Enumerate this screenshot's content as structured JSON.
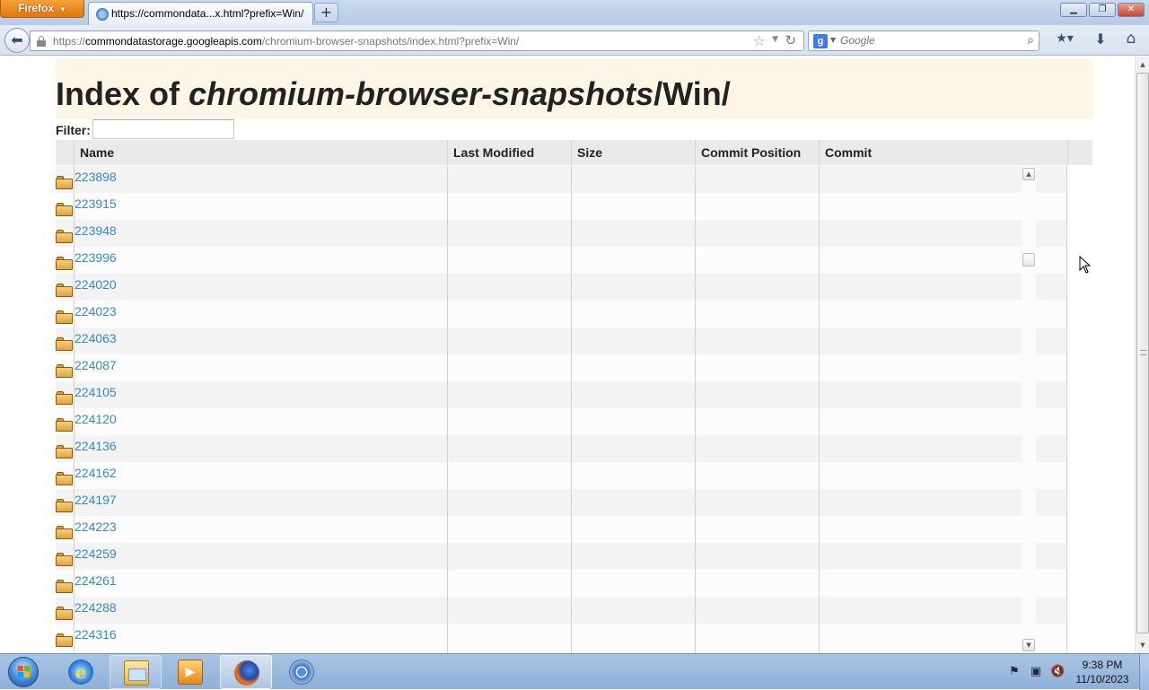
{
  "browser": {
    "menu_button": "Firefox",
    "tab_title": "https://commondata...x.html?prefix=Win/",
    "url_host": "commondatastorage.googleapis.com",
    "url_scheme": "https://",
    "url_path": "/chromium-browser-snapshots/index.html?prefix=Win/",
    "search_placeholder": "Google",
    "icons": [
      "back-icon",
      "lock-icon",
      "star-icon",
      "reload-icon",
      "google-icon",
      "search-icon",
      "bookmarks-icon",
      "download-icon",
      "home-icon"
    ]
  },
  "page": {
    "title_prefix": "Index of ",
    "title_bucket": "chromium-browser-snapshots",
    "title_suffix": "/Win/",
    "filter_label": "Filter:",
    "filter_value": "",
    "columns": [
      "Name",
      "Last Modified",
      "Size",
      "Commit Position",
      "Commit"
    ],
    "rows": [
      "223898",
      "223915",
      "223948",
      "223996",
      "224020",
      "224023",
      "224063",
      "224087",
      "224105",
      "224120",
      "224136",
      "224162",
      "224197",
      "224223",
      "224259",
      "224261",
      "224288",
      "224316"
    ],
    "link_color": "#3a87c8",
    "header_bg": "#fdf6e7"
  },
  "taskbar": {
    "apps": [
      "internet-explorer",
      "windows-explorer",
      "media-player",
      "firefox",
      "chrome"
    ],
    "time": "9:38 PM",
    "date": "11/10/2023"
  }
}
